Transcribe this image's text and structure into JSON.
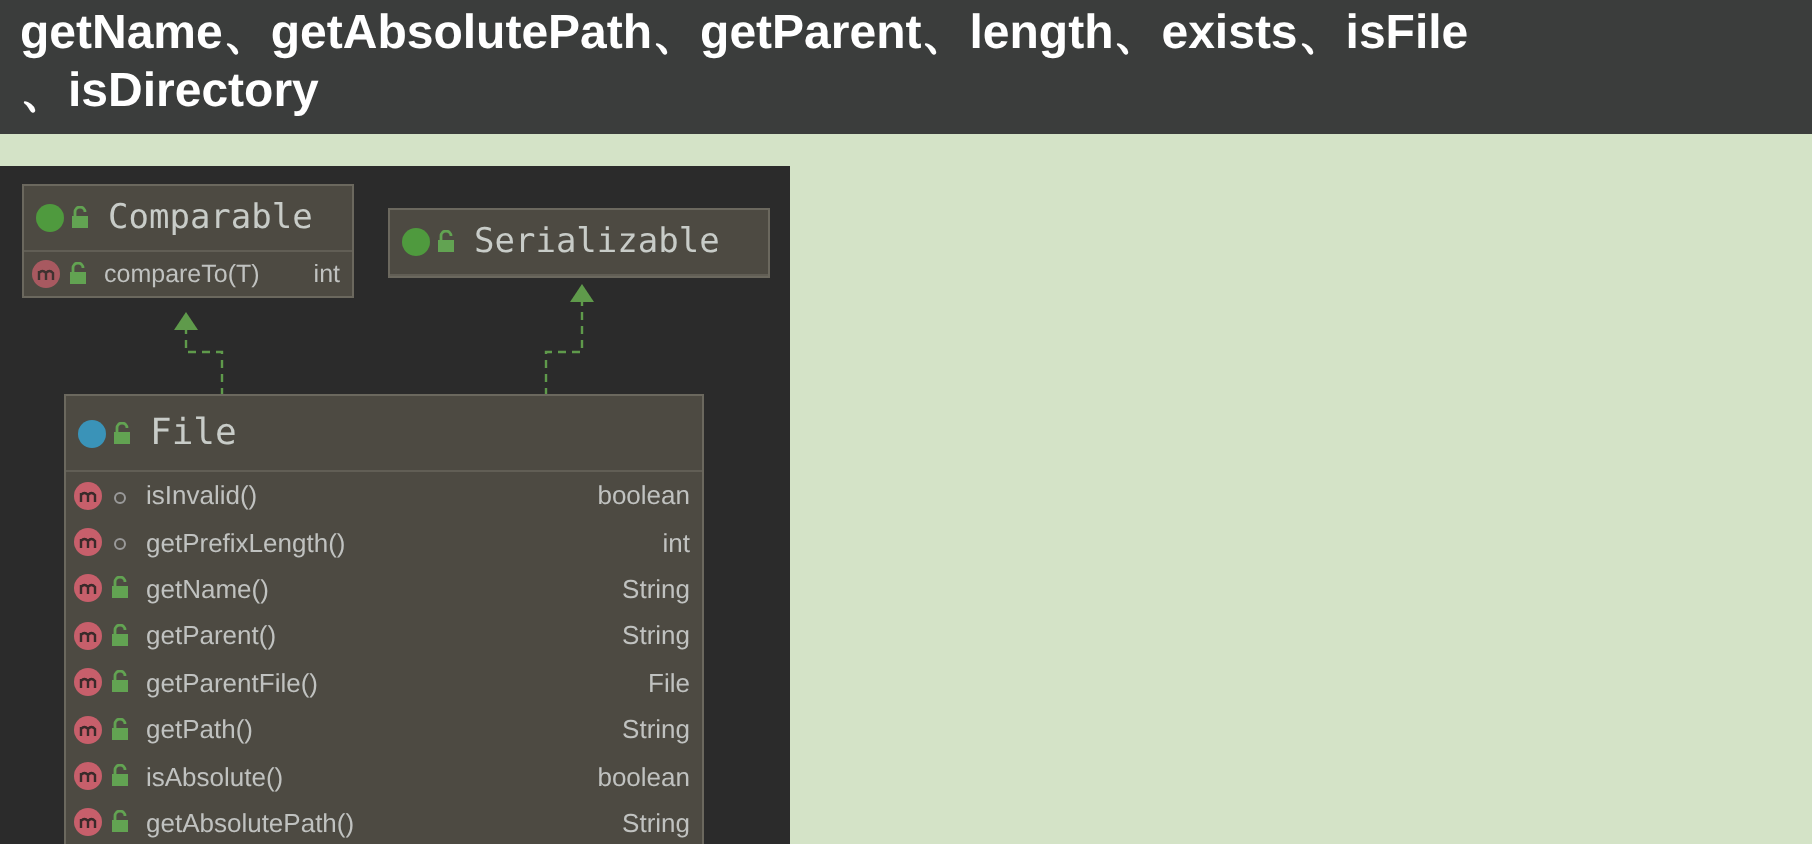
{
  "slide_title": "getName、getAbsolutePath、getParent、length、exists、isFile\n、isDirectory",
  "diagram": {
    "nodes": [
      {
        "kind": "interface",
        "name": "Comparable",
        "members": [
          {
            "name": "compareTo(T)",
            "type": "int",
            "public": true,
            "abstract": true
          }
        ]
      },
      {
        "kind": "interface",
        "name": "Serializable"
      },
      {
        "kind": "class",
        "name": "File",
        "members": [
          {
            "name": "isInvalid()",
            "type": "boolean",
            "public": false,
            "abstract": false
          },
          {
            "name": "getPrefixLength()",
            "type": "int",
            "public": false,
            "abstract": false
          },
          {
            "name": "getName()",
            "type": "String",
            "public": true,
            "abstract": false
          },
          {
            "name": "getParent()",
            "type": "String",
            "public": true,
            "abstract": false
          },
          {
            "name": "getParentFile()",
            "type": "File",
            "public": true,
            "abstract": false
          },
          {
            "name": "getPath()",
            "type": "String",
            "public": true,
            "abstract": false
          },
          {
            "name": "isAbsolute()",
            "type": "boolean",
            "public": true,
            "abstract": false
          },
          {
            "name": "getAbsolutePath()",
            "type": "String",
            "public": true,
            "abstract": false
          }
        ]
      }
    ]
  }
}
